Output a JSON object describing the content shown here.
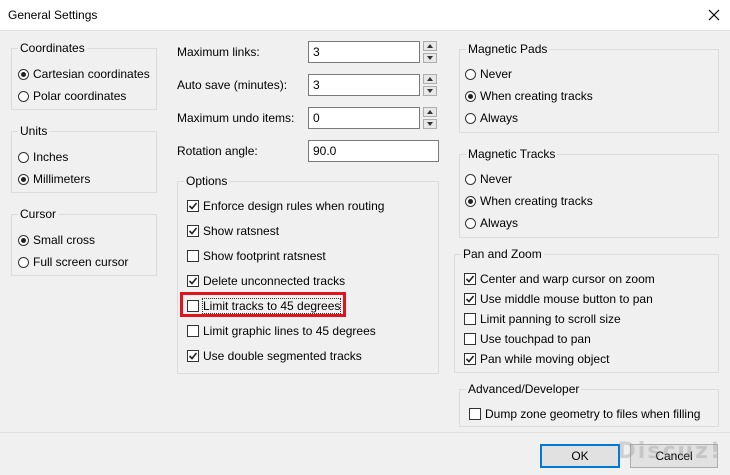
{
  "window": {
    "title": "General Settings"
  },
  "coordinates": {
    "legend": "Coordinates",
    "options": [
      {
        "label": "Cartesian coordinates",
        "selected": true
      },
      {
        "label": "Polar coordinates",
        "selected": false
      }
    ]
  },
  "units": {
    "legend": "Units",
    "options": [
      {
        "label": "Inches",
        "selected": false
      },
      {
        "label": "Millimeters",
        "selected": true
      }
    ]
  },
  "cursor": {
    "legend": "Cursor",
    "options": [
      {
        "label": "Small cross",
        "selected": true
      },
      {
        "label": "Full screen cursor",
        "selected": false
      }
    ]
  },
  "fields": {
    "max_links": {
      "label": "Maximum links:",
      "value": "3"
    },
    "auto_save": {
      "label": "Auto save (minutes):",
      "value": "3"
    },
    "max_undo": {
      "label": "Maximum undo items:",
      "value": "0"
    },
    "rotation": {
      "label": "Rotation angle:",
      "value": "90.0"
    }
  },
  "options": {
    "legend": "Options",
    "items": [
      {
        "label": "Enforce design rules when routing",
        "checked": true
      },
      {
        "label": "Show ratsnest",
        "checked": true
      },
      {
        "label": "Show footprint ratsnest",
        "checked": false
      },
      {
        "label": "Delete unconnected tracks",
        "checked": true
      },
      {
        "label": "Limit tracks to 45 degrees",
        "checked": false
      },
      {
        "label": "Limit graphic lines to 45 degrees",
        "checked": false
      },
      {
        "label": "Use double segmented tracks",
        "checked": true
      }
    ]
  },
  "magnetic_pads": {
    "legend": "Magnetic Pads",
    "options": [
      {
        "label": "Never",
        "selected": false
      },
      {
        "label": "When creating tracks",
        "selected": true
      },
      {
        "label": "Always",
        "selected": false
      }
    ]
  },
  "magnetic_tracks": {
    "legend": "Magnetic Tracks",
    "options": [
      {
        "label": "Never",
        "selected": false
      },
      {
        "label": "When creating tracks",
        "selected": true
      },
      {
        "label": "Always",
        "selected": false
      }
    ]
  },
  "pan_zoom": {
    "legend": "Pan and Zoom",
    "items": [
      {
        "label": "Center and warp cursor on zoom",
        "checked": true
      },
      {
        "label": "Use middle mouse button to pan",
        "checked": true
      },
      {
        "label": "Limit panning to scroll size",
        "checked": false
      },
      {
        "label": "Use touchpad to pan",
        "checked": false
      },
      {
        "label": "Pan while moving object",
        "checked": true
      }
    ]
  },
  "advanced": {
    "legend": "Advanced/Developer",
    "items": [
      {
        "label": "Dump zone geometry to files when filling",
        "checked": false
      }
    ]
  },
  "buttons": {
    "ok": "OK",
    "cancel": "Cancel"
  },
  "watermark": "Discuz!"
}
